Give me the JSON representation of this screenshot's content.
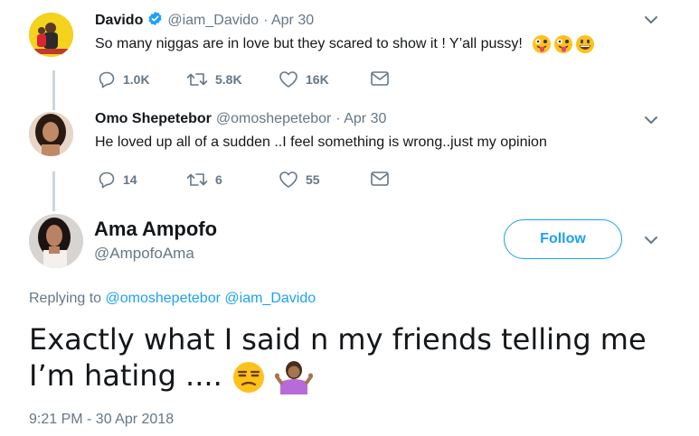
{
  "tweets": [
    {
      "name": "Davido",
      "verified": true,
      "handle": "@iam_Davido",
      "date": "· Apr 30",
      "text": "So many niggas are in love but they scared to show it ! Y’all pussy!",
      "emojis": [
        "zany-face-emoji",
        "zany-face-emoji",
        "grinning-face-emoji"
      ],
      "replies": "1.0K",
      "retweets": "5.8K",
      "likes": "16K"
    },
    {
      "name": "Omo Shepetebor",
      "handle": "@omoshepetebor",
      "date": "· Apr 30",
      "text": "He loved up all of a sudden ..I feel something is wrong..just my opinion",
      "replies": "14",
      "retweets": "6",
      "likes": "55"
    }
  ],
  "focused": {
    "name": "Ama Ampofo",
    "handle": "@AmpofoAma",
    "follow_label": "Follow",
    "replying_prefix": "Replying to",
    "replying_to": [
      "@omoshepetebor",
      "@iam_Davido"
    ],
    "text": "Exactly what I said n my friends telling me I’m hating ....",
    "emojis": [
      "unamused-face-emoji",
      "person-shrugging-emoji"
    ],
    "timestamp": "9:21 PM - 30 Apr 2018"
  },
  "colors": {
    "accent": "#1da1f2",
    "verified": "#1da1f2",
    "secondary_text": "#657786",
    "thread_line": "#ccd6dd"
  }
}
